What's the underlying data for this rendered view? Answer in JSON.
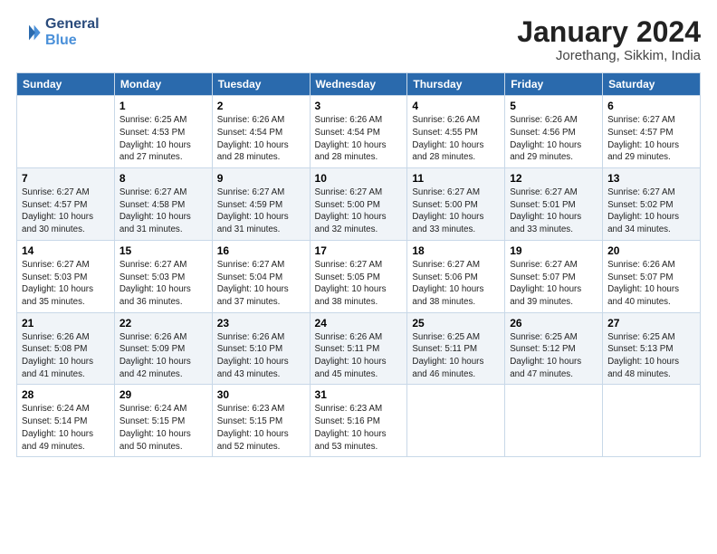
{
  "logo": {
    "line1": "General",
    "line2": "Blue"
  },
  "title": "January 2024",
  "location": "Jorethang, Sikkim, India",
  "weekdays": [
    "Sunday",
    "Monday",
    "Tuesday",
    "Wednesday",
    "Thursday",
    "Friday",
    "Saturday"
  ],
  "weeks": [
    [
      {
        "day": "",
        "info": ""
      },
      {
        "day": "1",
        "info": "Sunrise: 6:25 AM\nSunset: 4:53 PM\nDaylight: 10 hours\nand 27 minutes."
      },
      {
        "day": "2",
        "info": "Sunrise: 6:26 AM\nSunset: 4:54 PM\nDaylight: 10 hours\nand 28 minutes."
      },
      {
        "day": "3",
        "info": "Sunrise: 6:26 AM\nSunset: 4:54 PM\nDaylight: 10 hours\nand 28 minutes."
      },
      {
        "day": "4",
        "info": "Sunrise: 6:26 AM\nSunset: 4:55 PM\nDaylight: 10 hours\nand 28 minutes."
      },
      {
        "day": "5",
        "info": "Sunrise: 6:26 AM\nSunset: 4:56 PM\nDaylight: 10 hours\nand 29 minutes."
      },
      {
        "day": "6",
        "info": "Sunrise: 6:27 AM\nSunset: 4:57 PM\nDaylight: 10 hours\nand 29 minutes."
      }
    ],
    [
      {
        "day": "7",
        "info": "Sunrise: 6:27 AM\nSunset: 4:57 PM\nDaylight: 10 hours\nand 30 minutes."
      },
      {
        "day": "8",
        "info": "Sunrise: 6:27 AM\nSunset: 4:58 PM\nDaylight: 10 hours\nand 31 minutes."
      },
      {
        "day": "9",
        "info": "Sunrise: 6:27 AM\nSunset: 4:59 PM\nDaylight: 10 hours\nand 31 minutes."
      },
      {
        "day": "10",
        "info": "Sunrise: 6:27 AM\nSunset: 5:00 PM\nDaylight: 10 hours\nand 32 minutes."
      },
      {
        "day": "11",
        "info": "Sunrise: 6:27 AM\nSunset: 5:00 PM\nDaylight: 10 hours\nand 33 minutes."
      },
      {
        "day": "12",
        "info": "Sunrise: 6:27 AM\nSunset: 5:01 PM\nDaylight: 10 hours\nand 33 minutes."
      },
      {
        "day": "13",
        "info": "Sunrise: 6:27 AM\nSunset: 5:02 PM\nDaylight: 10 hours\nand 34 minutes."
      }
    ],
    [
      {
        "day": "14",
        "info": "Sunrise: 6:27 AM\nSunset: 5:03 PM\nDaylight: 10 hours\nand 35 minutes."
      },
      {
        "day": "15",
        "info": "Sunrise: 6:27 AM\nSunset: 5:03 PM\nDaylight: 10 hours\nand 36 minutes."
      },
      {
        "day": "16",
        "info": "Sunrise: 6:27 AM\nSunset: 5:04 PM\nDaylight: 10 hours\nand 37 minutes."
      },
      {
        "day": "17",
        "info": "Sunrise: 6:27 AM\nSunset: 5:05 PM\nDaylight: 10 hours\nand 38 minutes."
      },
      {
        "day": "18",
        "info": "Sunrise: 6:27 AM\nSunset: 5:06 PM\nDaylight: 10 hours\nand 38 minutes."
      },
      {
        "day": "19",
        "info": "Sunrise: 6:27 AM\nSunset: 5:07 PM\nDaylight: 10 hours\nand 39 minutes."
      },
      {
        "day": "20",
        "info": "Sunrise: 6:26 AM\nSunset: 5:07 PM\nDaylight: 10 hours\nand 40 minutes."
      }
    ],
    [
      {
        "day": "21",
        "info": "Sunrise: 6:26 AM\nSunset: 5:08 PM\nDaylight: 10 hours\nand 41 minutes."
      },
      {
        "day": "22",
        "info": "Sunrise: 6:26 AM\nSunset: 5:09 PM\nDaylight: 10 hours\nand 42 minutes."
      },
      {
        "day": "23",
        "info": "Sunrise: 6:26 AM\nSunset: 5:10 PM\nDaylight: 10 hours\nand 43 minutes."
      },
      {
        "day": "24",
        "info": "Sunrise: 6:26 AM\nSunset: 5:11 PM\nDaylight: 10 hours\nand 45 minutes."
      },
      {
        "day": "25",
        "info": "Sunrise: 6:25 AM\nSunset: 5:11 PM\nDaylight: 10 hours\nand 46 minutes."
      },
      {
        "day": "26",
        "info": "Sunrise: 6:25 AM\nSunset: 5:12 PM\nDaylight: 10 hours\nand 47 minutes."
      },
      {
        "day": "27",
        "info": "Sunrise: 6:25 AM\nSunset: 5:13 PM\nDaylight: 10 hours\nand 48 minutes."
      }
    ],
    [
      {
        "day": "28",
        "info": "Sunrise: 6:24 AM\nSunset: 5:14 PM\nDaylight: 10 hours\nand 49 minutes."
      },
      {
        "day": "29",
        "info": "Sunrise: 6:24 AM\nSunset: 5:15 PM\nDaylight: 10 hours\nand 50 minutes."
      },
      {
        "day": "30",
        "info": "Sunrise: 6:23 AM\nSunset: 5:15 PM\nDaylight: 10 hours\nand 52 minutes."
      },
      {
        "day": "31",
        "info": "Sunrise: 6:23 AM\nSunset: 5:16 PM\nDaylight: 10 hours\nand 53 minutes."
      },
      {
        "day": "",
        "info": ""
      },
      {
        "day": "",
        "info": ""
      },
      {
        "day": "",
        "info": ""
      }
    ]
  ]
}
